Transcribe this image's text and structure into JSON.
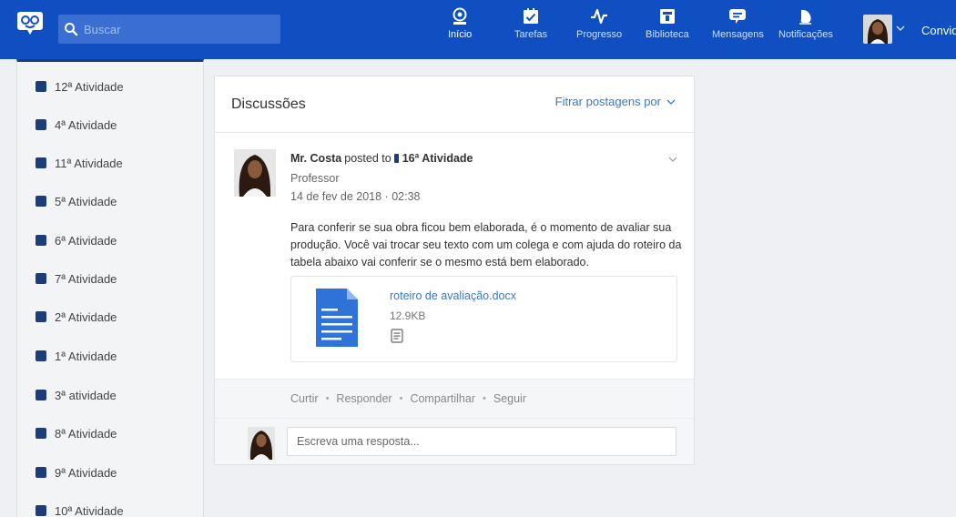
{
  "header": {
    "search_placeholder": "Buscar",
    "nav": [
      {
        "label": "Início",
        "icon": "home-icon"
      },
      {
        "label": "Tarefas",
        "icon": "tasks-icon"
      },
      {
        "label": "Progresso",
        "icon": "progress-icon"
      },
      {
        "label": "Biblioteca",
        "icon": "library-icon"
      },
      {
        "label": "Mensagens",
        "icon": "messages-icon"
      },
      {
        "label": "Notificações",
        "icon": "notifications-icon"
      }
    ],
    "user_name": "Convid"
  },
  "sidebar": {
    "items": [
      {
        "label": "12ª Atividade"
      },
      {
        "label": "4ª Atividade"
      },
      {
        "label": "11ª Atividade"
      },
      {
        "label": "5ª Atividade"
      },
      {
        "label": "6ª Atividade"
      },
      {
        "label": "7ª Atividade"
      },
      {
        "label": "2ª Atividade"
      },
      {
        "label": "1ª Atividade"
      },
      {
        "label": "3ª atividade"
      },
      {
        "label": "8ª Atividade"
      },
      {
        "label": "9ª Atividade"
      },
      {
        "label": "10ª Atividade"
      }
    ]
  },
  "discussions": {
    "title": "Discussões",
    "filter_label": "Fitrar postagens por"
  },
  "post": {
    "author": "Mr. Costa",
    "action": "posted to",
    "target_group": "16ª Atividade",
    "role": "Professor",
    "date": "14 de fev de 2018 · 02:38",
    "body": "Para conferir se sua obra ficou bem elaborada, é o momento de avaliar sua produção. Você vai trocar seu texto com um colega e com ajuda do roteiro da tabela abaixo vai conferir se o mesmo está bem elaborado.",
    "attachment": {
      "filename": "roteiro de avaliação.docx",
      "size": "12.9KB"
    },
    "actions": {
      "like": "Curtir",
      "reply": "Responder",
      "share": "Compartilhar",
      "follow": "Seguir"
    },
    "reply_placeholder": "Escreva uma resposta..."
  },
  "colors": {
    "topbar": "#0f4fc2",
    "link": "#3b76d0",
    "group_dot": "#1e3c78",
    "doc_icon": "#2f72d8"
  }
}
